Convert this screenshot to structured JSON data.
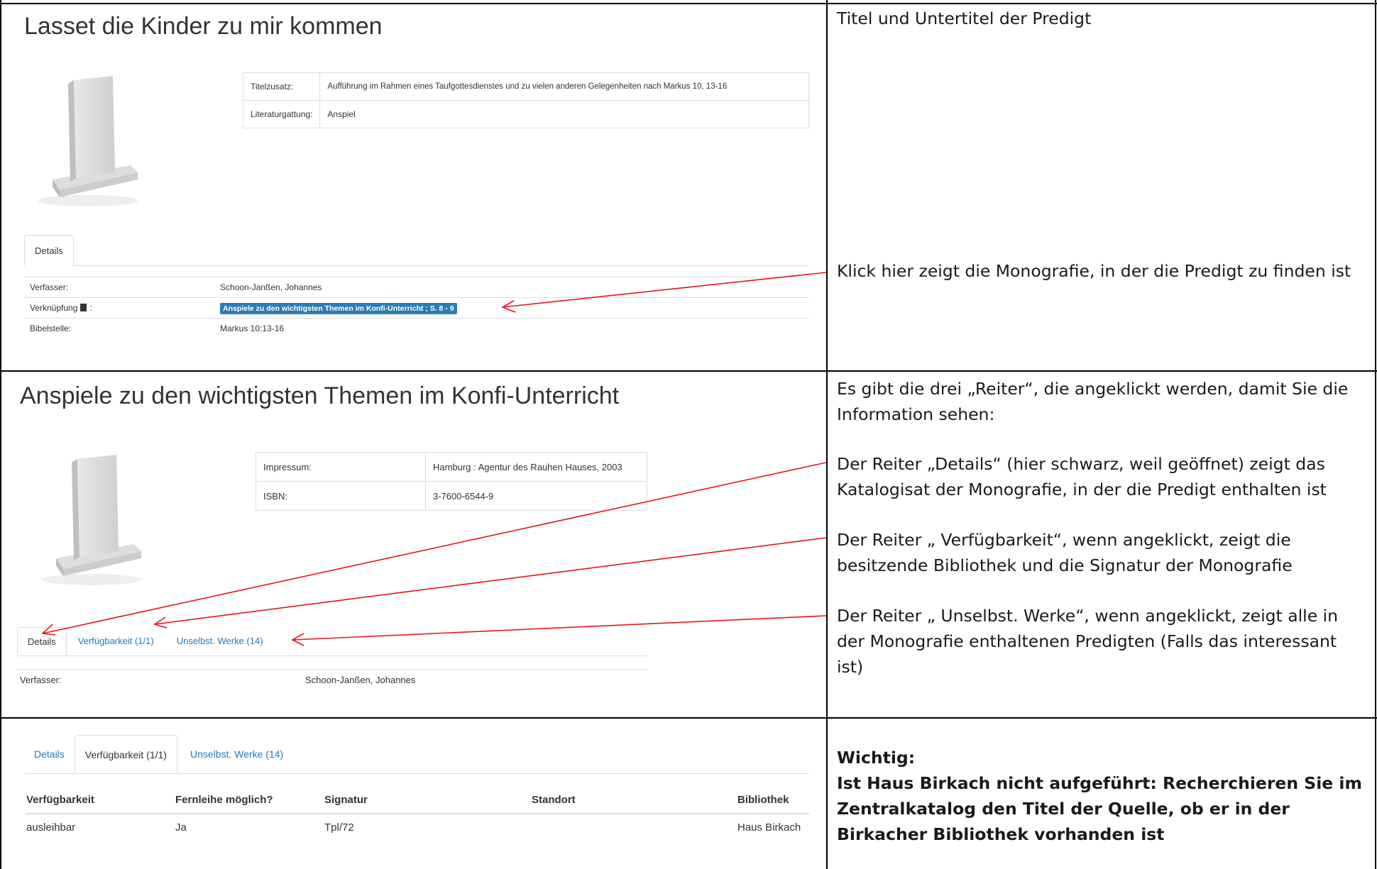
{
  "section1": {
    "title": "Lasset die Kinder zu mir kommen",
    "info": [
      {
        "key": "Titelzusatz:",
        "value": "Aufführung im Rahmen eines Taufgottesdienstes und zu vielen anderen Gelegenheiten nach Markus 10, 13-16"
      },
      {
        "key": "Literaturgattung:",
        "value": "Anspiel"
      }
    ],
    "tab_details": "Details",
    "details": {
      "verfasser_key": "Verfasser:",
      "verfasser_value": "Schoon-Janßen, Johannes",
      "verknuepfung_key": "Verknüpfung",
      "verknuepfung_colon": ":",
      "verknuepfung_value": "Anspiele zu den wichtigsten Themen im Konfi-Unterricht ; S. 8 - 9",
      "bibelstelle_key": "Bibelstelle:",
      "bibelstelle_value": "Markus 10:13-16"
    },
    "note_top": "Titel und Untertitel der Predigt",
    "note_link": "Klick hier zeigt die Monografie, in der die Predigt zu finden ist"
  },
  "section2": {
    "title": "Anspiele zu den wichtigsten Themen im Konfi-Unterricht",
    "info": [
      {
        "key": "Impressum:",
        "value": "Hamburg : Agentur des Rauhen Hauses, 2003"
      },
      {
        "key": "ISBN:",
        "value": "3-7600-6544-9"
      }
    ],
    "tabs": [
      "Details",
      "Verfügbarkeit (1/1)",
      "Unselbst. Werke (14)"
    ],
    "verfasser_key": "Verfasser:",
    "verfasser_value": "Schoon-Janßen, Johannes",
    "note_intro": "Es gibt die drei „Reiter“, die angeklickt werden, damit Sie die Information sehen:",
    "note_details": "Der Reiter „Details“ (hier schwarz, weil geöffnet) zeigt das Katalogisat der Monografie, in der die Predigt enthalten ist",
    "note_verfuegbarkeit": "Der Reiter „ Verfügbarkeit“, wenn angeklickt, zeigt die besitzende Bibliothek und die Signatur der Monografie",
    "note_unselbst": "Der Reiter „ Unselbst. Werke“, wenn angeklickt, zeigt alle in der Monografie enthaltenen Predigten (Falls das interessant ist)"
  },
  "section3": {
    "tabs": [
      "Details",
      "Verfügbarkeit (1/1)",
      "Unselbst. Werke (14)"
    ],
    "columns": [
      "Verfügbarkeit",
      "Fernleihe möglich?",
      "Signatur",
      "Standort",
      "Bibliothek"
    ],
    "rows": [
      [
        "ausleihbar",
        "Ja",
        "Tpl/72",
        "",
        "Haus Birkach"
      ]
    ],
    "note_heading": "Wichtig:",
    "note_body": "Ist Haus Birkach nicht aufgeführt: Recherchieren Sie im Zentralkatalog den Titel der Quelle, ob er in der Birkacher Bibliothek vorhanden ist"
  },
  "colors": {
    "arrow": "#e8141b",
    "link": "#1e7bb8",
    "badge": "#2a7db5"
  }
}
